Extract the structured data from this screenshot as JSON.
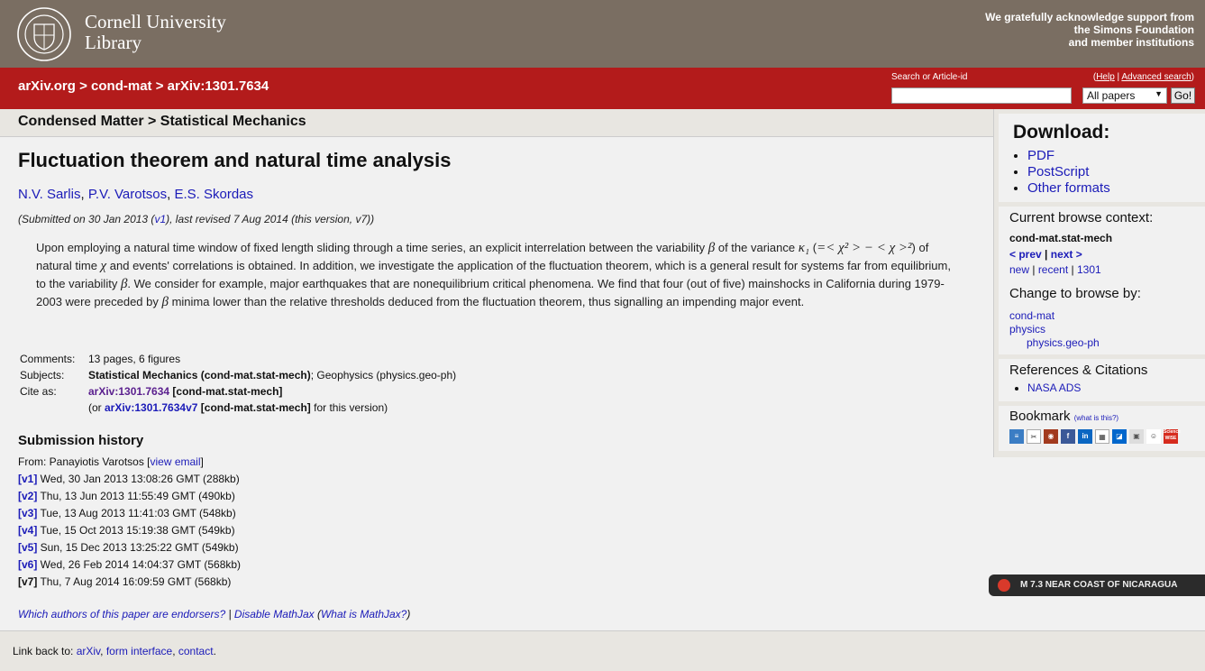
{
  "header": {
    "logo_line1": "Cornell University",
    "logo_line2": "Library",
    "support_line1": "We gratefully acknowledge support from",
    "support_line2": "the Simons Foundation",
    "support_line3": "and member institutions"
  },
  "redbar": {
    "crumb_arxiv": "arXiv.org",
    "crumb_sep1": " > ",
    "crumb_category": "cond-mat",
    "crumb_sep2": " > ",
    "crumb_id": "arXiv:1301.7634",
    "search_label": "Search or Article-id",
    "help_open": "(",
    "help": "Help",
    "help_sep": " | ",
    "advanced": "Advanced search",
    "help_close": ")",
    "search_value": "",
    "select_value": "All papers",
    "go": "Go!"
  },
  "subject_strip": "Condensed Matter > Statistical Mechanics",
  "paper": {
    "title": "Fluctuation theorem and natural time analysis",
    "authors": [
      "N.V. Sarlis",
      "P.V. Varotsos",
      "E.S. Skordas"
    ],
    "author_sep": ", ",
    "submitted_pre": "(Submitted on 30 Jan 2013 (",
    "submitted_v1": "v1",
    "submitted_post": "), last revised 7 Aug 2014 (this version, v7))",
    "abstract": {
      "p1": "Upon employing a natural time window of fixed length sliding through a time series, an explicit interrelation between the variability ",
      "beta": "β",
      "p2": " of the variance ",
      "kappa": "κ₁",
      "p3": " (",
      "eq": "=< χ² > − < χ >²",
      "p4": ") of natural time ",
      "chi": "χ",
      "p5": " and events' correlations is obtained. In addition, we investigate the application of the fluctuation theorem, which is a general result for systems far from equilibrium, to the variability ",
      "p6": ". We consider for example, major earthquakes that are nonequilibrium critical phenomena. We find that four (out of five) mainshocks in California during 1979-2003 were preceded by ",
      "p7": " minima lower than the relative thresholds deduced from the fluctuation theorem, thus signalling an impending major event."
    },
    "comments_label": "Comments:",
    "comments": "13 pages, 6 figures",
    "subjects_label": "Subjects:",
    "subjects_bold": "Statistical Mechanics (cond-mat.stat-mech)",
    "subjects_rest": "; Geophysics (physics.geo-ph)",
    "cite_label": "Cite as:",
    "cite_id": "arXiv:1301.7634",
    "cite_tag": " [cond-mat.stat-mech]",
    "cite2_pre": "(or ",
    "cite2_id": "arXiv:1301.7634v7",
    "cite2_tag": " [cond-mat.stat-mech]",
    "cite2_post": " for this version)"
  },
  "history": {
    "title": "Submission history",
    "from_pre": "From: Panayiotis Varotsos [",
    "view_email": "view email",
    "from_post": "]",
    "versions": [
      {
        "tag": "[v1]",
        "text": " Wed, 30 Jan 2013 13:08:26 GMT (288kb)"
      },
      {
        "tag": "[v2]",
        "text": " Thu, 13 Jun 2013 11:55:49 GMT (490kb)"
      },
      {
        "tag": "[v3]",
        "text": " Tue, 13 Aug 2013 11:41:03 GMT (548kb)"
      },
      {
        "tag": "[v4]",
        "text": " Tue, 15 Oct 2013 15:19:38 GMT (549kb)"
      },
      {
        "tag": "[v5]",
        "text": " Sun, 15 Dec 2013 13:25:22 GMT (549kb)"
      },
      {
        "tag": "[v6]",
        "text": " Wed, 26 Feb 2014 14:04:37 GMT (568kb)"
      },
      {
        "tag": "[v7]",
        "text": " Thu, 7 Aug 2014 16:09:59 GMT (568kb)"
      }
    ]
  },
  "footer_links": {
    "endorsers": "Which authors of this paper are endorsers?",
    "sep": " | ",
    "disable_mathjax": "Disable MathJax",
    "what_pre": " (",
    "what_mathjax": "What is MathJax?",
    "what_post": ")"
  },
  "bottom": {
    "pre": "Link back to: ",
    "arxiv": "arXiv",
    "sep1": ", ",
    "form": "form interface",
    "sep2": ", ",
    "contact": "contact",
    "post": "."
  },
  "sidebar": {
    "download_title": "Download:",
    "download_items": [
      "PDF",
      "PostScript",
      "Other formats"
    ],
    "context_title": "Current browse context:",
    "context_current": "cond-mat.stat-mech",
    "prev": "< prev",
    "pn_sep": " | ",
    "next": "next >",
    "new": "new",
    "recent": "recent",
    "month": "1301",
    "change_title": "Change to browse by:",
    "browse1": "cond-mat",
    "browse2": "physics",
    "browse3": "physics.geo-ph",
    "refs_title": "References & Citations",
    "nasa": "NASA ADS",
    "bookmark_title": "Bookmark",
    "bookmark_what": "(what is this?)",
    "science_wise": "Science WISE"
  },
  "quake": "M 7.3 NEAR COAST OF NICARAGUA"
}
